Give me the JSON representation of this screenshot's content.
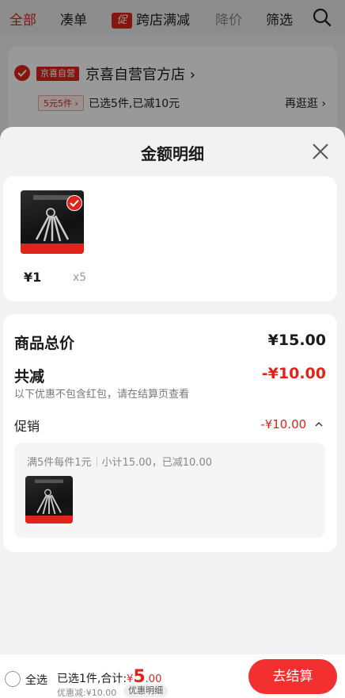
{
  "nav": {
    "tabs": [
      {
        "label": "全部"
      },
      {
        "label": "凑单"
      },
      {
        "badge": "促",
        "label": "跨店满减"
      },
      {
        "label": "降价"
      },
      {
        "label": "筛选"
      }
    ],
    "search_icon": "search-icon"
  },
  "shop": {
    "tag": "京喜自营",
    "name": "京喜自营官方店",
    "discount_tag": "5元5件",
    "status": "已选5件,已减10元",
    "more": "再逛逛"
  },
  "sheet": {
    "title": "金额明细",
    "close_icon": "close-icon",
    "product": {
      "price": "¥1",
      "quantity": "x5"
    },
    "summary": {
      "total_label": "商品总价",
      "total_value": "¥15.00",
      "discount_label": "共减",
      "discount_value": "-¥10.00",
      "note": "以下优惠不包含红包，请在结算页查看",
      "promo_label": "促销",
      "promo_value": "-¥10.00"
    },
    "promo_box": {
      "rule": "满5件每件1元",
      "subtotal": "小计15.00，已减10.00"
    }
  },
  "bottom_bar": {
    "select_all": "全选",
    "selected_prefix": "已选1件,合计:",
    "currency": "¥",
    "total_int": "5",
    "total_dec": ".00",
    "saved": "优惠减:¥10.00",
    "detail_tag": "优惠明细",
    "checkout": "去结算"
  },
  "colors": {
    "accent": "#e2231a",
    "checkout": "#f23030"
  }
}
